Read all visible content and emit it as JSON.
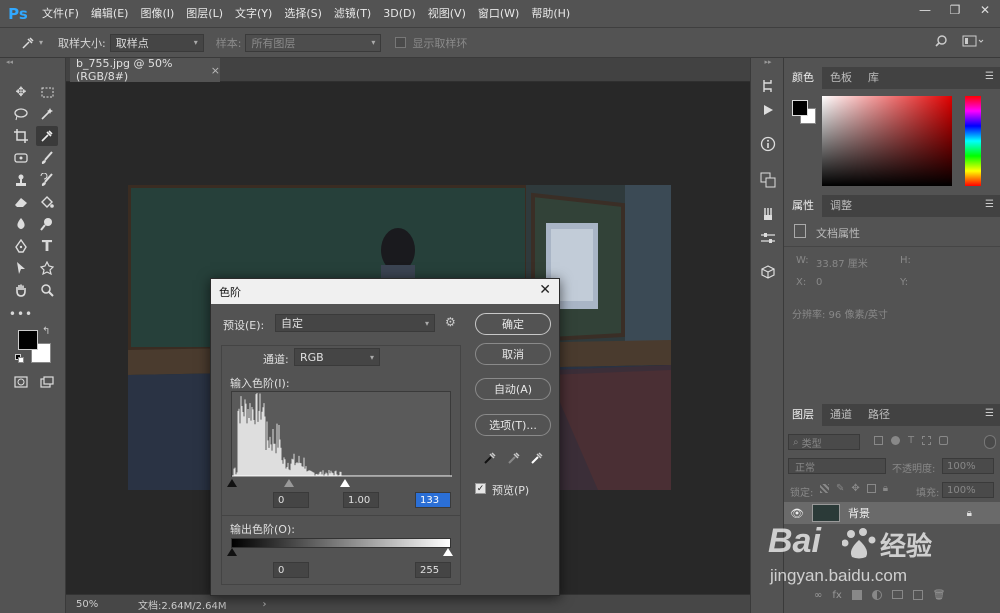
{
  "app": {
    "logo": "Ps"
  },
  "menu": [
    "文件(F)",
    "编辑(E)",
    "图像(I)",
    "图层(L)",
    "文字(Y)",
    "选择(S)",
    "滤镜(T)",
    "3D(D)",
    "视图(V)",
    "窗口(W)",
    "帮助(H)"
  ],
  "window_controls": {
    "minimize": "—",
    "restore": "❐",
    "close": "✕"
  },
  "options": {
    "sample_size_label": "取样大小:",
    "sample_size_value": "取样点",
    "sample_label": "样本:",
    "sample_value": "所有图层",
    "show_ring_label": "显示取样环"
  },
  "document": {
    "tab_title": "b_755.jpg @ 50%(RGB/8#)",
    "tab_close": "×",
    "zoom": "50%",
    "doc_info": "文档:2.64M/2.64M",
    "status_arrow": "›"
  },
  "panels": {
    "color_tabs": [
      "颜色",
      "色板",
      "库"
    ],
    "properties_tabs": [
      "属性",
      "调整"
    ],
    "doc_properties": "文档属性",
    "w_label": "W:",
    "w_value": "33.87 厘米",
    "h_label": "H:",
    "x_label": "X:",
    "x_value": "0",
    "y_label": "Y:",
    "resolution": "分辨率: 96 像素/英寸",
    "layers_tabs": [
      "图层",
      "通道",
      "路径"
    ],
    "kind_filter": "类型",
    "blend_mode": "正常",
    "opacity_label": "不透明度:",
    "opacity_value": "100%",
    "lock_label": "锁定:",
    "fill_label": "填充:",
    "fill_value": "100%",
    "layer_name": "背景"
  },
  "levels": {
    "title": "色阶",
    "close": "✕",
    "preset_label": "预设(E):",
    "preset_value": "自定",
    "channel_label": "通道:",
    "channel_value": "RGB",
    "input_label": "输入色阶(I):",
    "input_black": "0",
    "input_gamma": "1.00",
    "input_white": "133",
    "output_label": "输出色阶(O):",
    "output_black": "0",
    "output_white": "255",
    "buttons": {
      "ok": "确定",
      "cancel": "取消",
      "auto": "自动(A)",
      "options": "选项(T)..."
    },
    "preview_label": "预览(P)",
    "preview_checked": true
  },
  "watermark": {
    "brand": "Bai",
    "brand_suffix": "经验",
    "url": "jingyan.baidu.com"
  },
  "colors": {
    "accent": "#31a8ff",
    "selection": "#2b6fd6"
  }
}
